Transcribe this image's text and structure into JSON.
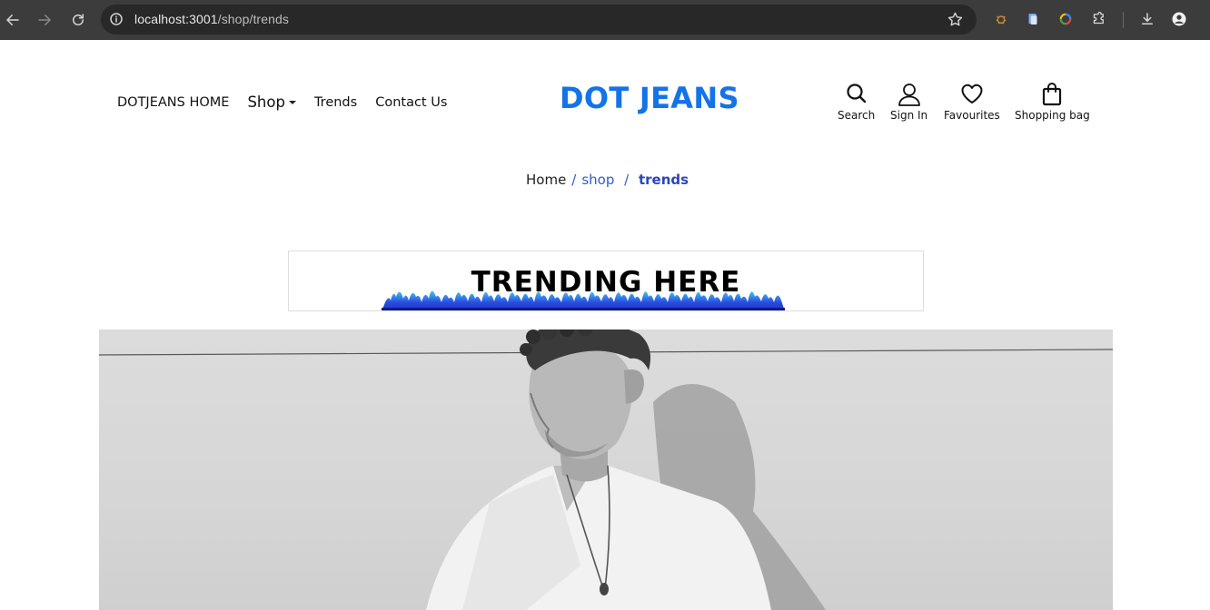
{
  "browser": {
    "url_host": "localhost:3001",
    "url_path": "/shop/trends"
  },
  "nav": {
    "home": "DOTJEANS HOME",
    "shop": "Shop",
    "trends": "Trends",
    "contact": "Contact Us"
  },
  "brand": "DOT JEANS",
  "actions": {
    "search": "Search",
    "sign_in": "Sign In",
    "favourites": "Favourites",
    "bag": "Shopping bag"
  },
  "breadcrumb": {
    "home": "Home",
    "shop": "shop",
    "current": "trends"
  },
  "banner": {
    "title": "TRENDING HERE"
  },
  "colors": {
    "brand": "#1473e6",
    "breadcrumb_link": "#2f5bd0",
    "flames": "#2b4ee0"
  }
}
